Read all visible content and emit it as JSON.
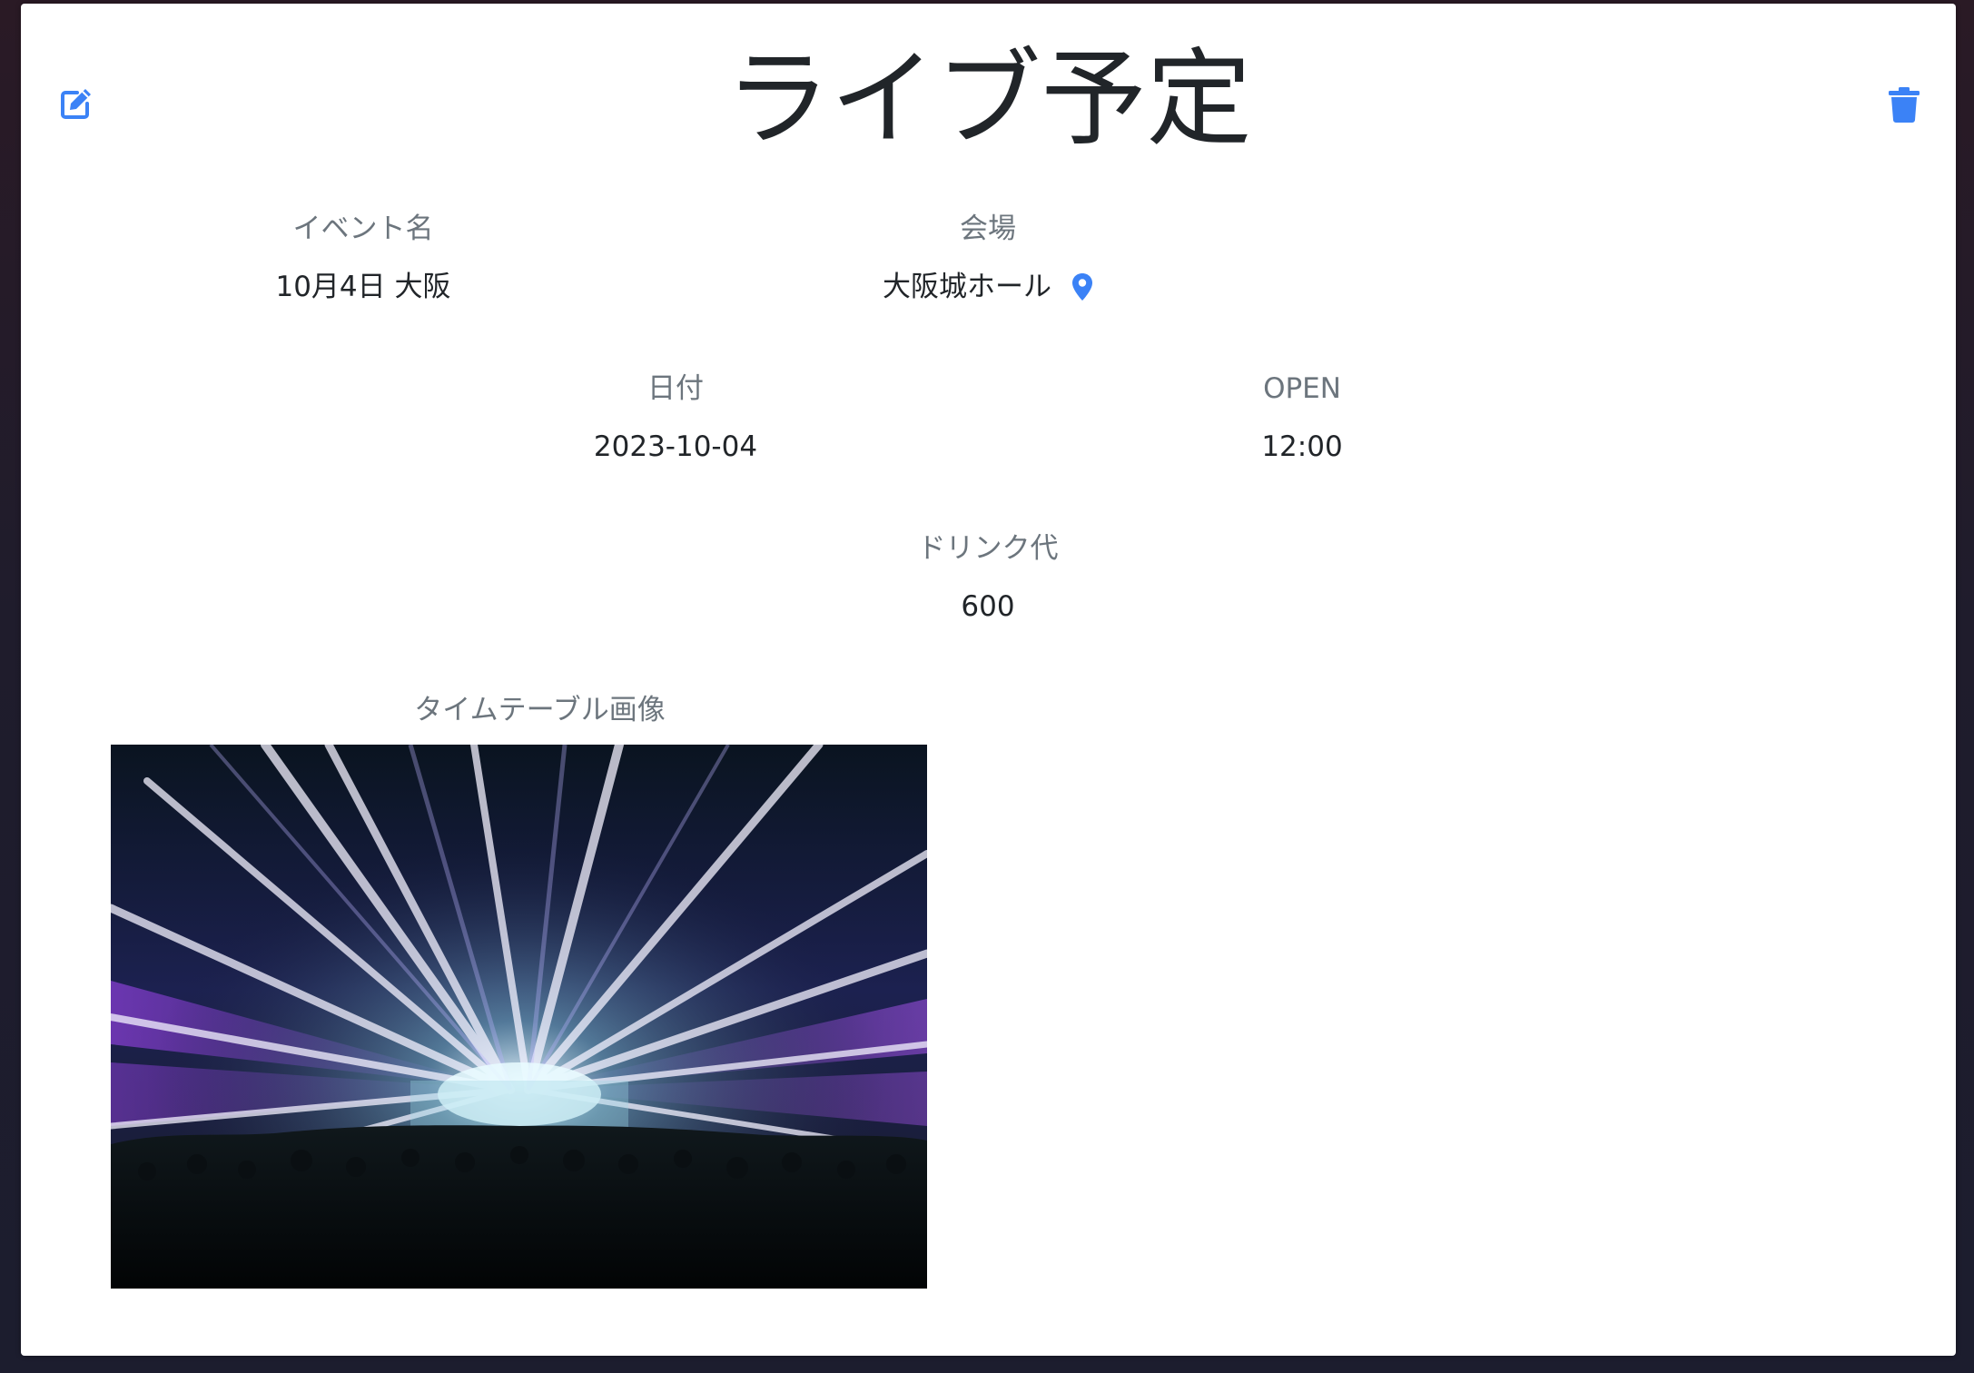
{
  "header": {
    "title": "ライブ予定",
    "edit_icon": "edit-icon",
    "delete_icon": "trash-icon"
  },
  "fields": {
    "event_name": {
      "label": "イベント名",
      "value": "10月4日 大阪"
    },
    "venue": {
      "label": "会場",
      "value": "大阪城ホール",
      "icon": "map-pin-icon"
    },
    "date": {
      "label": "日付",
      "value": "2023-10-04"
    },
    "open": {
      "label": "OPEN",
      "value": "12:00"
    },
    "drink": {
      "label": "ドリンク代",
      "value": "600"
    }
  },
  "timetable": {
    "label": "タイムテーブル画像"
  },
  "colors": {
    "accent": "#3b82f6",
    "label": "#6c757d",
    "text": "#212529",
    "background": "#ffffff"
  }
}
